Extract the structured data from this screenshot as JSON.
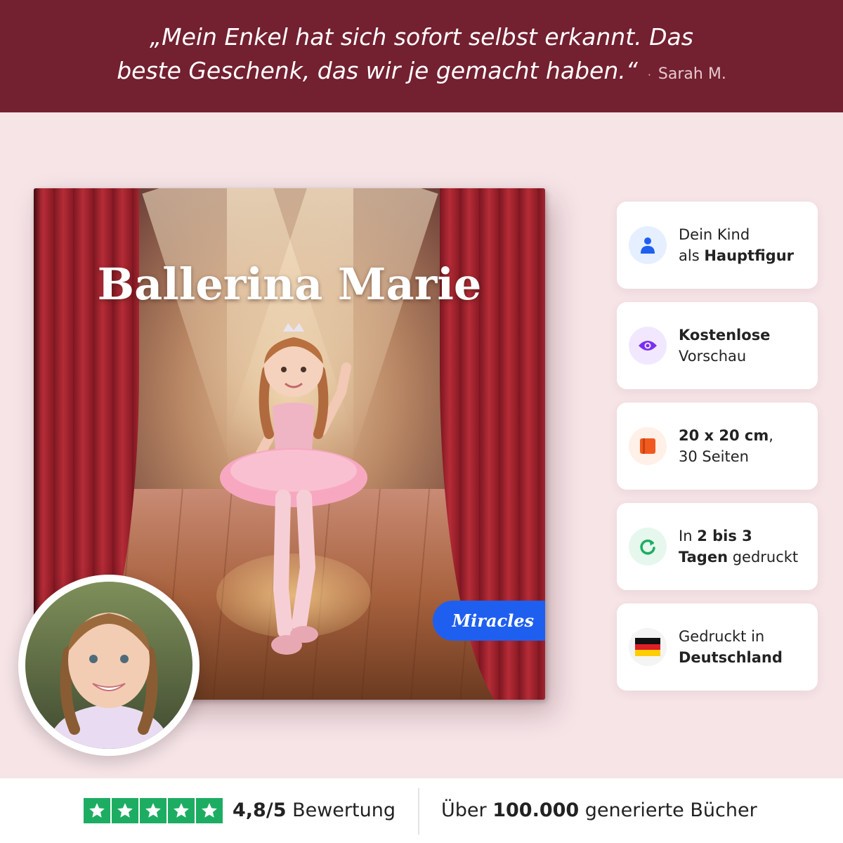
{
  "quote": {
    "line1": "„Mein Enkel hat sich sofort selbst erkannt. Das",
    "line2": "beste Geschenk, das wir je gemacht haben.“",
    "separator": "·",
    "author": "Sarah M."
  },
  "book": {
    "title": "Ballerina Marie",
    "brand": "Miracles"
  },
  "features": [
    {
      "icon": "person-icon",
      "pre": "Dein Kind",
      "mid": "als ",
      "bold": "Hauptfigur",
      "post": ""
    },
    {
      "icon": "eye-icon",
      "bold": "Kostenlose",
      "line2": "Vorschau"
    },
    {
      "icon": "book-icon",
      "bold": "20 x 20 cm",
      "post": ",",
      "line2": "30 Seiten"
    },
    {
      "icon": "refresh-icon",
      "pre": "In ",
      "bold1": "2 bis 3",
      "bold2": "Tagen",
      "post": " gedruckt"
    },
    {
      "icon": "germany-flag-icon",
      "line1": "Gedruckt in",
      "bold": "Deutschland"
    }
  ],
  "rating": {
    "stars": 5,
    "value": "4,8/5",
    "label": "Bewertung"
  },
  "stats": {
    "pre": "Über",
    "count": "100.000",
    "post": "generierte Bücher"
  },
  "colors": {
    "banner": "#732030",
    "background": "#f6e4e7",
    "star_green": "#1dad62",
    "brand_blue": "#1f5ff0"
  }
}
